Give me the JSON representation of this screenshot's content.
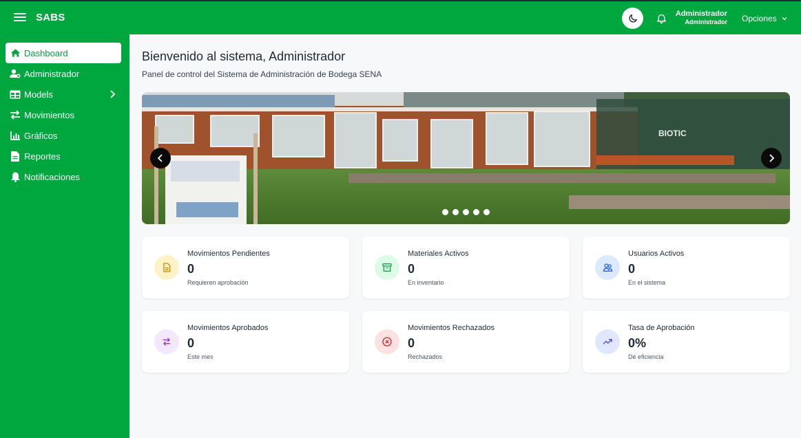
{
  "app": {
    "brand": "SABS"
  },
  "topbar": {
    "user_name": "Administrador",
    "user_role": "Administrador",
    "options_label": "Opciones"
  },
  "sidebar": {
    "items": [
      {
        "label": "Dashboard",
        "icon": "home-icon",
        "active": true
      },
      {
        "label": "Administrador",
        "icon": "user-cog-icon"
      },
      {
        "label": "Models",
        "icon": "table-icon",
        "has_children": true
      },
      {
        "label": "Movimientos",
        "icon": "exchange-icon"
      },
      {
        "label": "Gráficos",
        "icon": "bar-chart-icon"
      },
      {
        "label": "Reportes",
        "icon": "file-icon"
      },
      {
        "label": "Notificaciones",
        "icon": "bell-icon"
      }
    ]
  },
  "main": {
    "title": "Bienvenido al sistema, Administrador",
    "subtitle": "Panel de control del Sistema de Administración de Bodega SENA",
    "carousel": {
      "slides": 5,
      "active_slide": 0,
      "sign_text": "BIOTIC"
    },
    "cards": [
      {
        "label": "Movimientos Pendientes",
        "value": "0",
        "sub": "Requieren aprobación",
        "icon": "document-icon",
        "bg": "#fef3c7",
        "fg": "#ca8a04"
      },
      {
        "label": "Materiales Activos",
        "value": "0",
        "sub": "En inventario",
        "icon": "archive-icon",
        "bg": "#dcfce7",
        "fg": "#16a34a"
      },
      {
        "label": "Usuarios Activos",
        "value": "0",
        "sub": "En el sistema",
        "icon": "users-icon",
        "bg": "#dbeafe",
        "fg": "#2563eb"
      },
      {
        "label": "Movimientos Aprobados",
        "value": "0",
        "sub": "Este mes",
        "icon": "arrows-exchange-icon",
        "bg": "#f3e8ff",
        "fg": "#9333ea"
      },
      {
        "label": "Movimientos Rechazados",
        "value": "0",
        "sub": "Rechazados",
        "icon": "x-circle-icon",
        "bg": "#fee2e2",
        "fg": "#dc2626"
      },
      {
        "label": "Tasa de Aprobación",
        "value": "0%",
        "sub": "De eficiencia",
        "icon": "trending-up-icon",
        "bg": "#e0e7ff",
        "fg": "#4f46e5"
      }
    ]
  },
  "colors": {
    "brand": "#00a63e",
    "background": "#f7f8fa"
  }
}
